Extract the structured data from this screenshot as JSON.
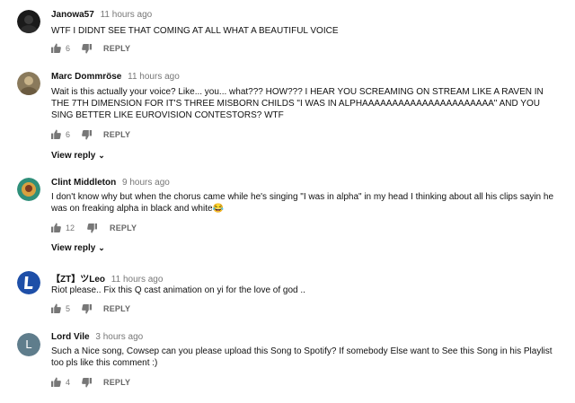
{
  "comments": [
    {
      "author": "Janowa57",
      "time": "11 hours ago",
      "text": "WTF I DIDNT SEE THAT COMING AT ALL WHAT A BEAUTIFUL VOICE",
      "likes": "6",
      "reply": "REPLY"
    },
    {
      "author": "Marc Dommröse",
      "time": "11 hours ago",
      "text": "Wait is this actually your voice? Like... you... what??? HOW??? I HEAR YOU SCREAMING ON STREAM LIKE A RAVEN IN THE 7TH DIMENSION FOR IT'S THREE MISBORN CHILDS \"I WAS IN ALPHAAAAAAAAAAAAAAAAAAAAAA\" AND YOU SING BETTER LIKE EUROVISION CONTESTORS? WTF",
      "likes": "6",
      "reply": "REPLY",
      "view_replies": "View reply"
    },
    {
      "author": "Clint Middleton",
      "time": "9 hours ago",
      "text": "I don't know why but when the chorus came while he's singing \"I was in alpha\" in my head I thinking about all his clips sayin he was on freaking alpha in black and white😂",
      "likes": "12",
      "reply": "REPLY",
      "view_replies": "View reply"
    },
    {
      "author": "【ZT】ツLeo",
      "time": "11 hours ago",
      "text": "Riot please.. Fix this Q cast animation on yi for the love of god ..",
      "likes": "5",
      "reply": "REPLY"
    },
    {
      "author": "Lord Vile",
      "time": "3 hours ago",
      "text": "Such a Nice song, Cowsep can you please upload this Song to Spotify? If somebody Else want to See this Song in his Playlist too pls like this comment :)",
      "likes": "4",
      "reply": "REPLY",
      "avatar_letter": "L"
    }
  ],
  "colors": {
    "avatar_l_bg": "#5f7d8c",
    "meta_gray": "#777777",
    "text": "#111111"
  }
}
